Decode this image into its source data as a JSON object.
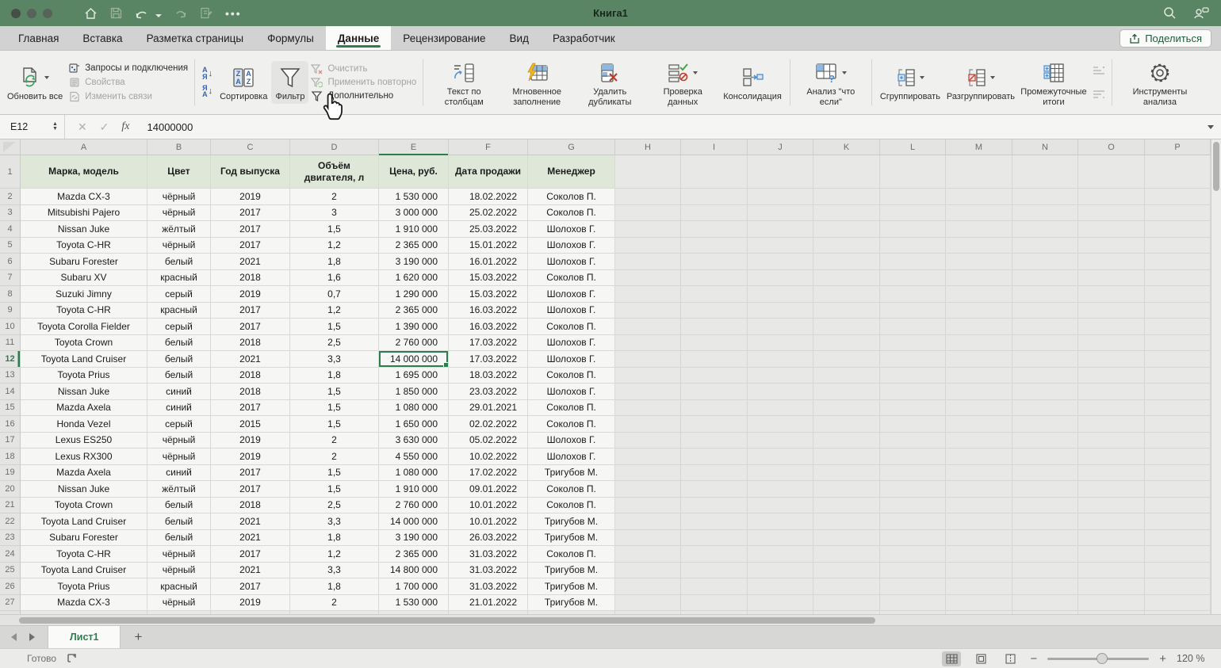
{
  "titlebar": {
    "title": "Книга1"
  },
  "tabs": [
    {
      "label": "Главная",
      "active": false
    },
    {
      "label": "Вставка",
      "active": false
    },
    {
      "label": "Разметка страницы",
      "active": false
    },
    {
      "label": "Формулы",
      "active": false
    },
    {
      "label": "Данные",
      "active": true
    },
    {
      "label": "Рецензирование",
      "active": false
    },
    {
      "label": "Вид",
      "active": false
    },
    {
      "label": "Разработчик",
      "active": false
    }
  ],
  "share_button": {
    "label": "Поделиться"
  },
  "ribbon": {
    "refresh_all": "Обновить все",
    "queries": "Запросы и подключения",
    "properties": "Свойства",
    "edit_links": "Изменить связи",
    "sort": "Сортировка",
    "filter": "Фильтр",
    "clear": "Очистить",
    "reapply": "Применить повторно",
    "advanced": "Дополнительно",
    "text_to_columns": "Текст по столбцам",
    "flash_fill": "Мгновенное заполнение",
    "remove_duplicates": "Удалить дубликаты",
    "data_validation": "Проверка данных",
    "consolidate": "Консолидация",
    "what_if": "Анализ \"что если\"",
    "group": "Сгруппировать",
    "ungroup": "Разгруппировать",
    "subtotal": "Промежуточные итоги",
    "analysis_tools": "Инструменты анализа"
  },
  "formula_bar": {
    "cell_ref": "E12",
    "formula_value": "14000000"
  },
  "sheet": {
    "column_letters": [
      "A",
      "B",
      "C",
      "D",
      "E",
      "F",
      "G",
      "H",
      "I",
      "J",
      "K",
      "L",
      "M",
      "N",
      "O",
      "P"
    ],
    "selected_column": "E",
    "selected_row": 12,
    "first_data_row": 2,
    "headers": [
      "Марка, модель",
      "Цвет",
      "Год выпуска",
      "Объём двигателя, л",
      "Цена, руб.",
      "Дата продажи",
      "Менеджер"
    ],
    "rows": [
      [
        "Mazda CX-3",
        "чёрный",
        "2019",
        "2",
        "1 530 000",
        "18.02.2022",
        "Соколов П."
      ],
      [
        "Mitsubishi Pajero",
        "чёрный",
        "2017",
        "3",
        "3 000 000",
        "25.02.2022",
        "Соколов П."
      ],
      [
        "Nissan Juke",
        "жёлтый",
        "2017",
        "1,5",
        "1 910 000",
        "25.03.2022",
        "Шолохов Г."
      ],
      [
        "Toyota C-HR",
        "чёрный",
        "2017",
        "1,2",
        "2 365 000",
        "15.01.2022",
        "Шолохов Г."
      ],
      [
        "Subaru Forester",
        "белый",
        "2021",
        "1,8",
        "3 190 000",
        "16.01.2022",
        "Шолохов Г."
      ],
      [
        "Subaru XV",
        "красный",
        "2018",
        "1,6",
        "1 620 000",
        "15.03.2022",
        "Соколов П."
      ],
      [
        "Suzuki Jimny",
        "серый",
        "2019",
        "0,7",
        "1 290 000",
        "15.03.2022",
        "Шолохов Г."
      ],
      [
        "Toyota C-HR",
        "красный",
        "2017",
        "1,2",
        "2 365 000",
        "16.03.2022",
        "Шолохов Г."
      ],
      [
        "Toyota Corolla Fielder",
        "серый",
        "2017",
        "1,5",
        "1 390 000",
        "16.03.2022",
        "Соколов П."
      ],
      [
        "Toyota Crown",
        "белый",
        "2018",
        "2,5",
        "2 760 000",
        "17.03.2022",
        "Шолохов Г."
      ],
      [
        "Toyota Land Cruiser",
        "белый",
        "2021",
        "3,3",
        "14 000 000",
        "17.03.2022",
        "Шолохов Г."
      ],
      [
        "Toyota Prius",
        "белый",
        "2018",
        "1,8",
        "1 695 000",
        "18.03.2022",
        "Соколов П."
      ],
      [
        "Nissan Juke",
        "синий",
        "2018",
        "1,5",
        "1 850 000",
        "23.03.2022",
        "Шолохов Г."
      ],
      [
        "Mazda Axela",
        "синий",
        "2017",
        "1,5",
        "1 080 000",
        "29.01.2021",
        "Соколов П."
      ],
      [
        "Honda Vezel",
        "серый",
        "2015",
        "1,5",
        "1 650 000",
        "02.02.2022",
        "Соколов П."
      ],
      [
        "Lexus ES250",
        "чёрный",
        "2019",
        "2",
        "3 630 000",
        "05.02.2022",
        "Шолохов Г."
      ],
      [
        "Lexus RX300",
        "чёрный",
        "2019",
        "2",
        "4 550 000",
        "10.02.2022",
        "Шолохов Г."
      ],
      [
        "Mazda Axela",
        "синий",
        "2017",
        "1,5",
        "1 080 000",
        "17.02.2022",
        "Тригубов М."
      ],
      [
        "Nissan Juke",
        "жёлтый",
        "2017",
        "1,5",
        "1 910 000",
        "09.01.2022",
        "Соколов П."
      ],
      [
        "Toyota Crown",
        "белый",
        "2018",
        "2,5",
        "2 760 000",
        "10.01.2022",
        "Соколов П."
      ],
      [
        "Toyota Land Cruiser",
        "белый",
        "2021",
        "3,3",
        "14 000 000",
        "10.01.2022",
        "Тригубов М."
      ],
      [
        "Subaru Forester",
        "белый",
        "2021",
        "1,8",
        "3 190 000",
        "26.03.2022",
        "Тригубов М."
      ],
      [
        "Toyota C-HR",
        "чёрный",
        "2017",
        "1,2",
        "2 365 000",
        "31.03.2022",
        "Соколов П."
      ],
      [
        "Toyota Land Cruiser",
        "чёрный",
        "2021",
        "3,3",
        "14 800 000",
        "31.03.2022",
        "Тригубов М."
      ],
      [
        "Toyota Prius",
        "красный",
        "2017",
        "1,8",
        "1 700 000",
        "31.03.2022",
        "Тригубов М."
      ],
      [
        "Mazda CX-3",
        "чёрный",
        "2019",
        "2",
        "1 530 000",
        "21.01.2022",
        "Тригубов М."
      ]
    ]
  },
  "sheet_tabs": {
    "active_tab": "Лист1",
    "add_label": "+"
  },
  "status_bar": {
    "mode": "Готово",
    "zoom_level": "120 %"
  },
  "colors": {
    "titlebar_green": "#5a8565",
    "accent_green": "#2e7d4f",
    "header_fill": "#dfe8d8"
  }
}
